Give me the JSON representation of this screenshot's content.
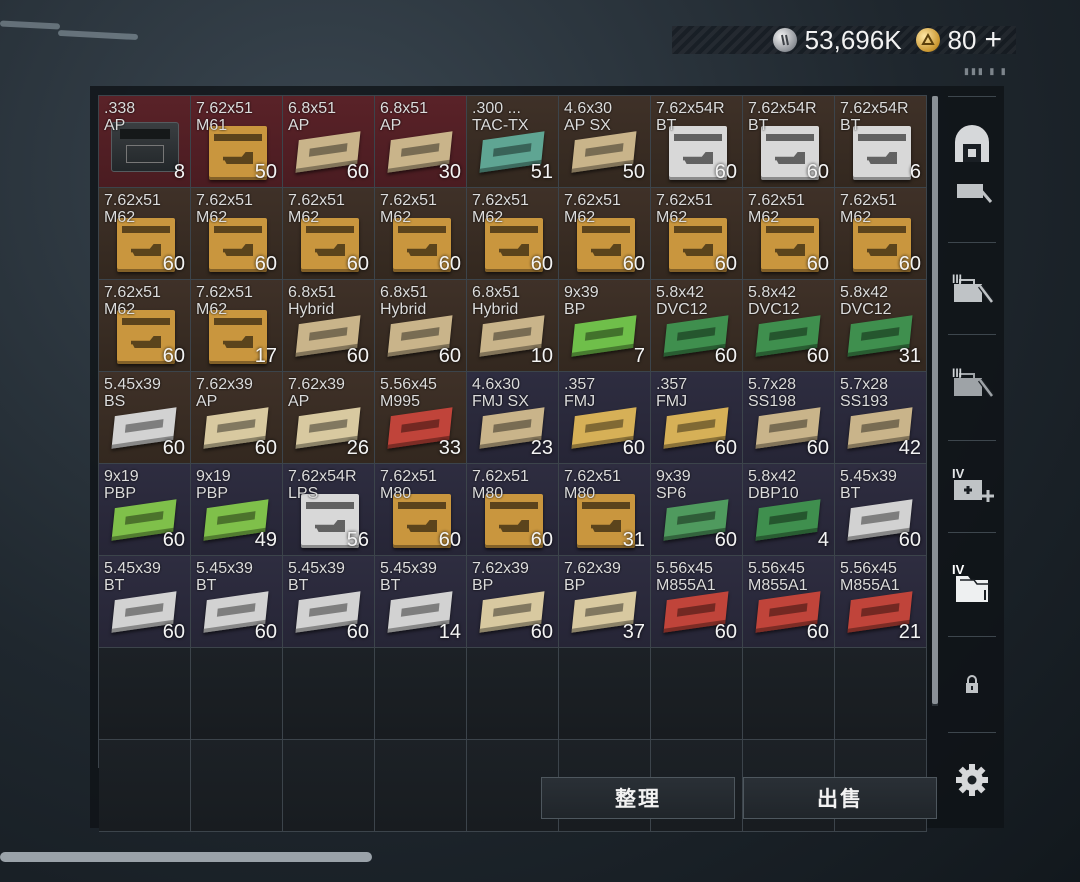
{
  "currencies": [
    {
      "icon": "silver-coin-icon",
      "value": "53,696K"
    },
    {
      "icon": "gold-coin-icon",
      "value": "80",
      "plus": "+"
    }
  ],
  "grid": [
    {
      "label": ".338\nAP",
      "count": "8",
      "bg": "red",
      "box": "can",
      "color": "#2b2f31"
    },
    {
      "label": "7.62x51\nM61",
      "count": "50",
      "bg": "red",
      "box": "tall",
      "color": "#c9963e"
    },
    {
      "label": "6.8x51\nAP",
      "count": "60",
      "bg": "red",
      "box": "flat",
      "color": "#c9b48a"
    },
    {
      "label": "6.8x51\nAP",
      "count": "30",
      "bg": "red",
      "box": "flat",
      "color": "#c9b48a"
    },
    {
      "label": ".300 ...\nTAC-TX",
      "count": "51",
      "bg": "brown",
      "box": "flat",
      "color": "#5fa593"
    },
    {
      "label": "4.6x30\nAP SX",
      "count": "50",
      "bg": "brown",
      "box": "flat",
      "color": "#c9b48a"
    },
    {
      "label": "7.62x54R\nBT",
      "count": "60",
      "bg": "brown",
      "box": "tall",
      "color": "#d8d8d8"
    },
    {
      "label": "7.62x54R\nBT",
      "count": "60",
      "bg": "brown",
      "box": "tall",
      "color": "#d8d8d8"
    },
    {
      "label": "7.62x54R\nBT",
      "count": "6",
      "bg": "brown",
      "box": "tall",
      "color": "#d8d8d8"
    },
    {
      "label": "7.62x51\nM62",
      "count": "60",
      "bg": "brown",
      "box": "tall",
      "color": "#c9963e"
    },
    {
      "label": "7.62x51\nM62",
      "count": "60",
      "bg": "brown",
      "box": "tall",
      "color": "#c9963e"
    },
    {
      "label": "7.62x51\nM62",
      "count": "60",
      "bg": "brown",
      "box": "tall",
      "color": "#c9963e"
    },
    {
      "label": "7.62x51\nM62",
      "count": "60",
      "bg": "brown",
      "box": "tall",
      "color": "#c9963e"
    },
    {
      "label": "7.62x51\nM62",
      "count": "60",
      "bg": "brown",
      "box": "tall",
      "color": "#c9963e"
    },
    {
      "label": "7.62x51\nM62",
      "count": "60",
      "bg": "brown",
      "box": "tall",
      "color": "#c9963e"
    },
    {
      "label": "7.62x51\nM62",
      "count": "60",
      "bg": "brown",
      "box": "tall",
      "color": "#c9963e"
    },
    {
      "label": "7.62x51\nM62",
      "count": "60",
      "bg": "brown",
      "box": "tall",
      "color": "#c9963e"
    },
    {
      "label": "7.62x51\nM62",
      "count": "60",
      "bg": "brown",
      "box": "tall",
      "color": "#c9963e"
    },
    {
      "label": "7.62x51\nM62",
      "count": "60",
      "bg": "brown",
      "box": "tall",
      "color": "#c9963e"
    },
    {
      "label": "7.62x51\nM62",
      "count": "17",
      "bg": "brown",
      "box": "tall",
      "color": "#c9963e"
    },
    {
      "label": "6.8x51\nHybrid",
      "count": "60",
      "bg": "brown",
      "box": "flat",
      "color": "#c9b48a"
    },
    {
      "label": "6.8x51\nHybrid",
      "count": "60",
      "bg": "brown",
      "box": "flat",
      "color": "#c9b48a"
    },
    {
      "label": "6.8x51\nHybrid",
      "count": "10",
      "bg": "brown",
      "box": "flat",
      "color": "#c9b48a"
    },
    {
      "label": "9x39\nBP",
      "count": "7",
      "bg": "brown",
      "box": "flat",
      "color": "#6fbf4a"
    },
    {
      "label": "5.8x42\nDVC12",
      "count": "60",
      "bg": "brown",
      "box": "flat",
      "color": "#3f8f4e"
    },
    {
      "label": "5.8x42\nDVC12",
      "count": "60",
      "bg": "brown",
      "box": "flat",
      "color": "#3f8f4e"
    },
    {
      "label": "5.8x42\nDVC12",
      "count": "31",
      "bg": "brown",
      "box": "flat",
      "color": "#3f8f4e"
    },
    {
      "label": "5.45x39\nBS",
      "count": "60",
      "bg": "brown",
      "box": "flat",
      "color": "#d2d2d2"
    },
    {
      "label": "7.62x39\nAP",
      "count": "60",
      "bg": "brown",
      "box": "flat",
      "color": "#d8c9a0"
    },
    {
      "label": "7.62x39\nAP",
      "count": "26",
      "bg": "brown",
      "box": "flat",
      "color": "#d8c9a0"
    },
    {
      "label": "5.56x45\nM995",
      "count": "33",
      "bg": "brown",
      "box": "flat",
      "color": "#c0443a"
    },
    {
      "label": "4.6x30\nFMJ SX",
      "count": "23",
      "bg": "navy",
      "box": "flat",
      "color": "#c9b48a"
    },
    {
      "label": ".357\nFMJ",
      "count": "60",
      "bg": "navy",
      "box": "flat",
      "color": "#d6b057"
    },
    {
      "label": ".357\nFMJ",
      "count": "60",
      "bg": "navy",
      "box": "flat",
      "color": "#d6b057"
    },
    {
      "label": "5.7x28\nSS198",
      "count": "60",
      "bg": "navy",
      "box": "flat",
      "color": "#c9b48a"
    },
    {
      "label": "5.7x28\nSS193",
      "count": "42",
      "bg": "navy",
      "box": "flat",
      "color": "#c9b48a"
    },
    {
      "label": "9x19\nPBP",
      "count": "60",
      "bg": "navy",
      "box": "flat",
      "color": "#7fc04a"
    },
    {
      "label": "9x19\nPBP",
      "count": "49",
      "bg": "navy",
      "box": "flat",
      "color": "#7fc04a"
    },
    {
      "label": "7.62x54R\nLPS",
      "count": "56",
      "bg": "navy",
      "box": "tall",
      "color": "#d8d8d8"
    },
    {
      "label": "7.62x51\nM80",
      "count": "60",
      "bg": "navy",
      "box": "tall",
      "color": "#c9963e"
    },
    {
      "label": "7.62x51\nM80",
      "count": "60",
      "bg": "navy",
      "box": "tall",
      "color": "#c9963e"
    },
    {
      "label": "7.62x51\nM80",
      "count": "31",
      "bg": "navy",
      "box": "tall",
      "color": "#c9963e"
    },
    {
      "label": "9x39\nSP6",
      "count": "60",
      "bg": "navy",
      "box": "flat",
      "color": "#4f9a5e"
    },
    {
      "label": "5.8x42\nDBP10",
      "count": "4",
      "bg": "navy",
      "box": "flat",
      "color": "#3f8f4e"
    },
    {
      "label": "5.45x39\nBT",
      "count": "60",
      "bg": "navy",
      "box": "flat",
      "color": "#d2d2d2"
    },
    {
      "label": "5.45x39\nBT",
      "count": "60",
      "bg": "navy",
      "box": "flat",
      "color": "#d2d2d2"
    },
    {
      "label": "5.45x39\nBT",
      "count": "60",
      "bg": "navy",
      "box": "flat",
      "color": "#d2d2d2"
    },
    {
      "label": "5.45x39\nBT",
      "count": "60",
      "bg": "navy",
      "box": "flat",
      "color": "#d2d2d2"
    },
    {
      "label": "5.45x39\nBT",
      "count": "14",
      "bg": "navy",
      "box": "flat",
      "color": "#d2d2d2"
    },
    {
      "label": "7.62x39\nBP",
      "count": "60",
      "bg": "navy",
      "box": "flat",
      "color": "#d8c9a0"
    },
    {
      "label": "7.62x39\nBP",
      "count": "37",
      "bg": "navy",
      "box": "flat",
      "color": "#d8c9a0"
    },
    {
      "label": "5.56x45\nM855A1",
      "count": "60",
      "bg": "navy",
      "box": "flat",
      "color": "#c0443a"
    },
    {
      "label": "5.56x45\nM855A1",
      "count": "60",
      "bg": "navy",
      "box": "flat",
      "color": "#c0443a"
    },
    {
      "label": "5.56x45\nM855A1",
      "count": "21",
      "bg": "navy",
      "box": "flat",
      "color": "#c0443a"
    }
  ],
  "empty_cells": 18,
  "rail": {
    "tab_labels": [
      "III",
      "III",
      "IV",
      "IV"
    ]
  },
  "actions": {
    "sort_label": "整理",
    "sell_label": "出售"
  }
}
